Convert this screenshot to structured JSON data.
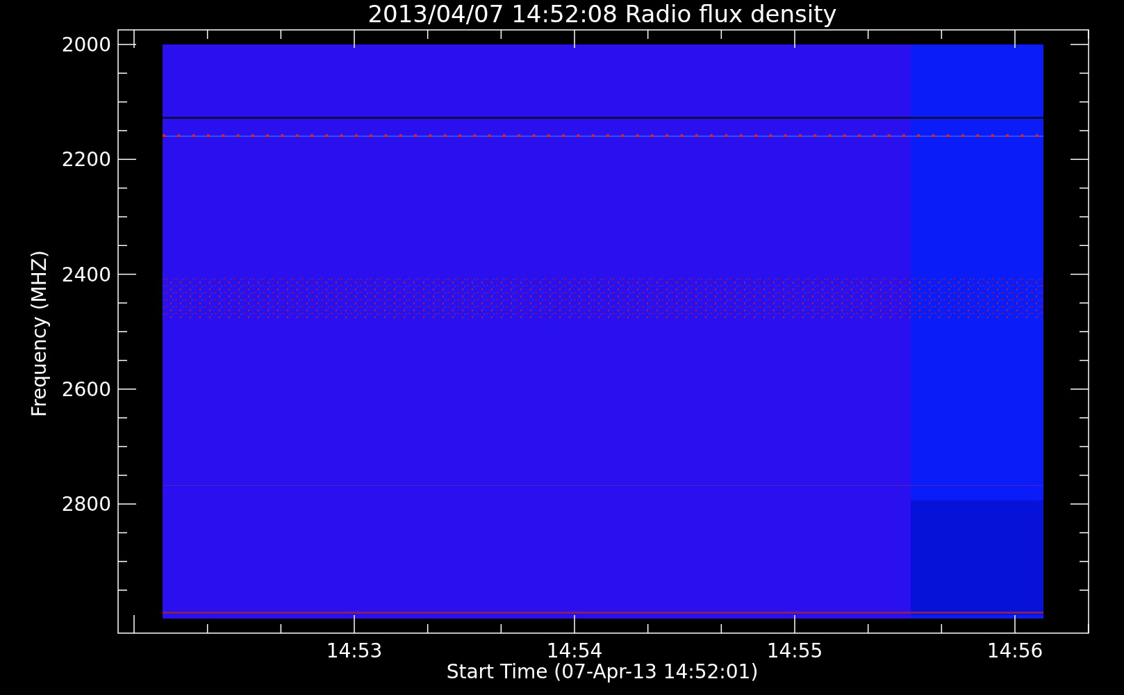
{
  "title": "2013/04/07 14:52:08 Radio flux density",
  "y_axis": {
    "label": "Frequency (MHZ)",
    "ticks": [
      "2000",
      "2200",
      "2400",
      "2600",
      "2800"
    ]
  },
  "x_axis": {
    "label": "Start Time (07-Apr-13 14:52:01)",
    "ticks": [
      "14:53",
      "14:54",
      "14:55",
      "14:56"
    ]
  }
}
